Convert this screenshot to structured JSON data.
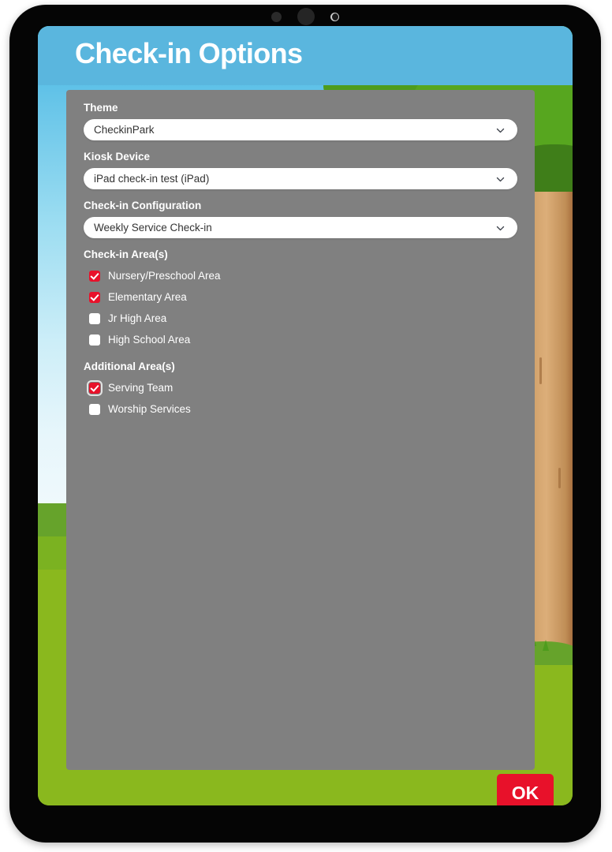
{
  "device": {
    "type": "tablet",
    "camera_icons": [
      "microphone-dot",
      "camera-lens",
      "light-sensor"
    ]
  },
  "header": {
    "title": "Check-in Options",
    "background_color": "#5ab6de"
  },
  "theme_colors": {
    "accent_red": "#e8112a",
    "panel_gray": "#808080",
    "grass_green": "#8ab81e",
    "sky_blue": "#5ab6de"
  },
  "fields": [
    {
      "label": "Theme",
      "name": "theme-select",
      "value": "CheckinPark",
      "icon": "chevron-down-icon"
    },
    {
      "label": "Kiosk Device",
      "name": "kiosk-device-select",
      "value": "iPad check-in test (iPad)",
      "icon": "chevron-down-icon"
    },
    {
      "label": "Check-in Configuration",
      "name": "checkin-configuration-select",
      "value": "Weekly Service Check-in",
      "icon": "chevron-down-icon"
    }
  ],
  "checkin_areas": {
    "title": "Check-in Area(s)",
    "items": [
      {
        "label": "Nursery/Preschool Area",
        "checked": true,
        "focused": false
      },
      {
        "label": "Elementary Area",
        "checked": true,
        "focused": false
      },
      {
        "label": "Jr High Area",
        "checked": false,
        "focused": false
      },
      {
        "label": "High School Area",
        "checked": false,
        "focused": false
      }
    ]
  },
  "additional_areas": {
    "title": "Additional Area(s)",
    "items": [
      {
        "label": "Serving Team",
        "checked": true,
        "focused": true
      },
      {
        "label": "Worship Services",
        "checked": false,
        "focused": false
      }
    ]
  },
  "footer": {
    "ok_label": "OK"
  }
}
